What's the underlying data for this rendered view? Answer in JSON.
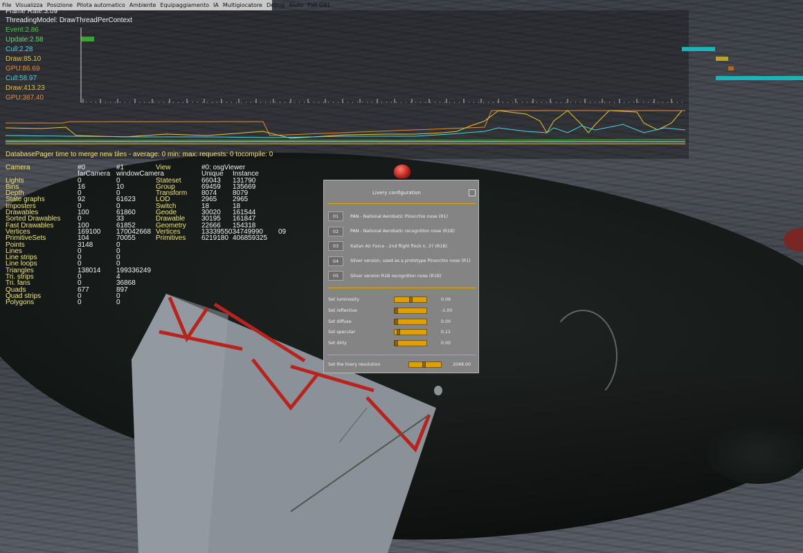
{
  "menubar": {
    "items": [
      "File",
      "Visualizza",
      "Posizione",
      "Pilota automatico",
      "Ambiente",
      "Equipaggiamento",
      "IA",
      "Multigiocatore",
      "Debug",
      "Aiuto",
      "Fiat G91"
    ]
  },
  "stats": {
    "frame_rate": "Frame Rate:3.09",
    "threading": "ThreadingModel:  DrawThreadPerContext",
    "event": "Event:2.86",
    "update": "Update:2.58",
    "cull1": "Cull:2.28",
    "draw1": "Draw:85.10",
    "gpu1": "GPU:86.69",
    "cull2": "Cull:58.97",
    "draw2": "Draw:413.23",
    "gpu2": "GPU:387.40",
    "pager": "DatabasePager time to merge new tiles - average:    0      min:            max:       requests:     0  tocompile:     0"
  },
  "colors": {
    "event": "#3bd23b",
    "update": "#62e062",
    "cull": "#48d8e6",
    "draw": "#e8c932",
    "gpu": "#e88b32",
    "accent": "#e0a000"
  },
  "camera_table": {
    "rows": [
      [
        "Camera",
        "#0",
        "#1",
        "View",
        "#0: osgViewer",
        ""
      ],
      [
        "",
        "farCamera",
        "windowCamera",
        "",
        "Unique",
        "Instance"
      ],
      [
        "Lights",
        "0",
        "0",
        "Stateset",
        "66043",
        "131790"
      ],
      [
        "Bins",
        "16",
        "10",
        "Group",
        "69459",
        "135669"
      ],
      [
        "Depth",
        "0",
        "0",
        "Transform",
        "8074",
        "8079"
      ],
      [
        "State graphs",
        "92",
        "61623",
        "LOD",
        "2965",
        "2965"
      ],
      [
        "Imposters",
        "0",
        "0",
        "Switch",
        "18",
        "18"
      ],
      [
        "Drawables",
        "100",
        "61860",
        "Geode",
        "30020",
        "161544"
      ],
      [
        "Sorted Drawables",
        "0",
        "33",
        "Drawable",
        "30195",
        "161847"
      ],
      [
        "Fast Drawables",
        "100",
        "61852",
        "Geometry",
        "22666",
        "154318"
      ],
      [
        "Vertices",
        "169100",
        "170042668",
        "Vertices",
        "1333955034749990",
        "09"
      ],
      [
        "PrimitiveSets",
        "104",
        "70055",
        "Primitives",
        "6219180",
        "406859325"
      ],
      [
        "Points",
        "3148",
        "0",
        "",
        "",
        ""
      ],
      [
        "Lines",
        "0",
        "0",
        "",
        "",
        ""
      ],
      [
        "Line strips",
        "0",
        "0",
        "",
        "",
        ""
      ],
      [
        "Line loops",
        "0",
        "0",
        "",
        "",
        ""
      ],
      [
        "Triangles",
        "138014",
        "199336249",
        "",
        "",
        ""
      ],
      [
        "Tri. strips",
        "0",
        "4",
        "",
        "",
        ""
      ],
      [
        "Tri. fans",
        "0",
        "36868",
        "",
        "",
        ""
      ],
      [
        "Quads",
        "677",
        "897",
        "",
        "",
        ""
      ],
      [
        "Quad strips",
        "0",
        "0",
        "",
        "",
        ""
      ],
      [
        "Polygons",
        "0",
        "0",
        "",
        "",
        ""
      ]
    ]
  },
  "dialog": {
    "title": "Livery configuration",
    "liveries": [
      {
        "num": "01",
        "label": "PAN - National Aerobatic Pinocchio nose (R1)"
      },
      {
        "num": "02",
        "label": "PAN - National Aerobatic recognition nose (R1B)"
      },
      {
        "num": "03",
        "label": "Italian Air Force - 2nd flight flock n. 37 (R1B)"
      },
      {
        "num": "04",
        "label": "Silver version, used as a prototype Pinocchio nose (R1)"
      },
      {
        "num": "05",
        "label": "Silver version R1B recognition nose (R1B)"
      }
    ],
    "sliders": [
      {
        "label": "Set luminosity",
        "value": "0.09",
        "level": 0.5
      },
      {
        "label": "Set reflective",
        "value": "-1.00",
        "level": 0.0
      },
      {
        "label": "Set diffuse",
        "value": "0.00",
        "level": 0.0
      },
      {
        "label": "Set specular",
        "value": "0.11",
        "level": 0.06
      },
      {
        "label": "Set dirty",
        "value": "0.00",
        "level": 0.0
      }
    ],
    "resolution": {
      "label": "Set the livery resolution",
      "value": "2048.00",
      "level": 0.45
    }
  }
}
